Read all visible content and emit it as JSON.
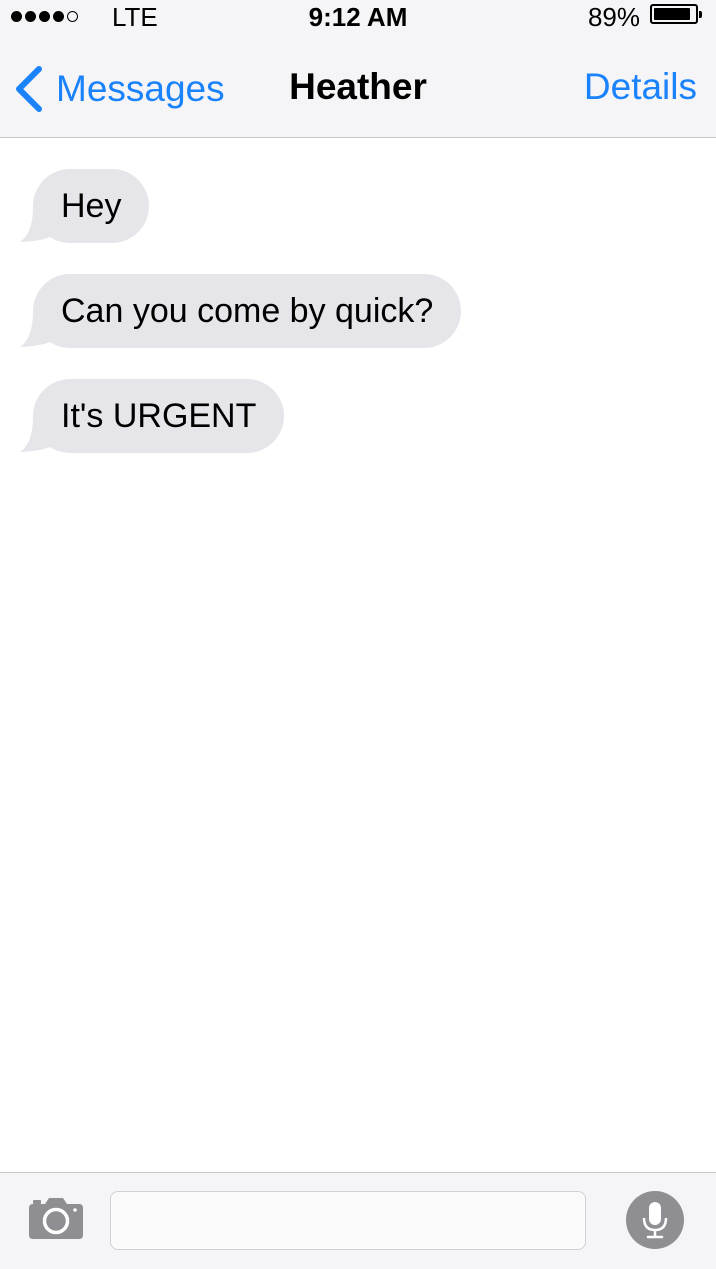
{
  "status_bar": {
    "carrier": "LTE",
    "time": "9:12 AM",
    "battery_percent": "89%",
    "battery_level": 0.89,
    "signal_bars_filled": 4,
    "signal_bars_total": 5
  },
  "nav": {
    "back_label": "Messages",
    "title": "Heather",
    "details_label": "Details"
  },
  "messages": [
    {
      "direction": "incoming",
      "text": "Hey"
    },
    {
      "direction": "incoming",
      "text": "Can you come by quick?"
    },
    {
      "direction": "incoming",
      "text": "It's URGENT"
    }
  ],
  "composer": {
    "value": "",
    "placeholder": ""
  },
  "icons": {
    "back": "chevron-left-icon",
    "camera": "camera-icon",
    "mic": "microphone-icon"
  },
  "colors": {
    "accent": "#1a82fb",
    "bubble_incoming": "#e5e5ea",
    "bar_background": "#f5f5f7",
    "mic_background": "#8e8e93"
  }
}
